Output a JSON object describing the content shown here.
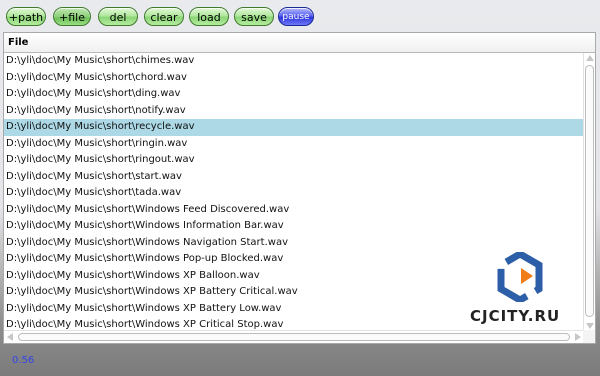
{
  "toolbar": {
    "add_path": "+path",
    "add_file": "+file",
    "del": "del",
    "clear": "clear",
    "load": "load",
    "save": "save",
    "pause": "pause"
  },
  "table": {
    "header": "File",
    "selected_index": 4,
    "rows": [
      "D:\\yli\\doc\\My Music\\short\\chimes.wav",
      "D:\\yli\\doc\\My Music\\short\\chord.wav",
      "D:\\yli\\doc\\My Music\\short\\ding.wav",
      "D:\\yli\\doc\\My Music\\short\\notify.wav",
      "D:\\yli\\doc\\My Music\\short\\recycle.wav",
      "D:\\yli\\doc\\My Music\\short\\ringin.wav",
      "D:\\yli\\doc\\My Music\\short\\ringout.wav",
      "D:\\yli\\doc\\My Music\\short\\start.wav",
      "D:\\yli\\doc\\My Music\\short\\tada.wav",
      "D:\\yli\\doc\\My Music\\short\\Windows Feed Discovered.wav",
      "D:\\yli\\doc\\My Music\\short\\Windows Information Bar.wav",
      "D:\\yli\\doc\\My Music\\short\\Windows Navigation Start.wav",
      "D:\\yli\\doc\\My Music\\short\\Windows Pop-up Blocked.wav",
      "D:\\yli\\doc\\My Music\\short\\Windows XP Balloon.wav",
      "D:\\yli\\doc\\My Music\\short\\Windows XP Battery Critical.wav",
      "D:\\yli\\doc\\My Music\\short\\Windows XP Battery Low.wav",
      "D:\\yli\\doc\\My Music\\short\\Windows XP Critical Stop.wav"
    ]
  },
  "status": {
    "value": "0.56"
  },
  "watermark": {
    "text": "CJCITY.RU"
  },
  "colors": {
    "selection": "#add8e6",
    "button_green": "#a6e491",
    "button_blue": "#3a43e6",
    "status_text": "#3245e8"
  }
}
